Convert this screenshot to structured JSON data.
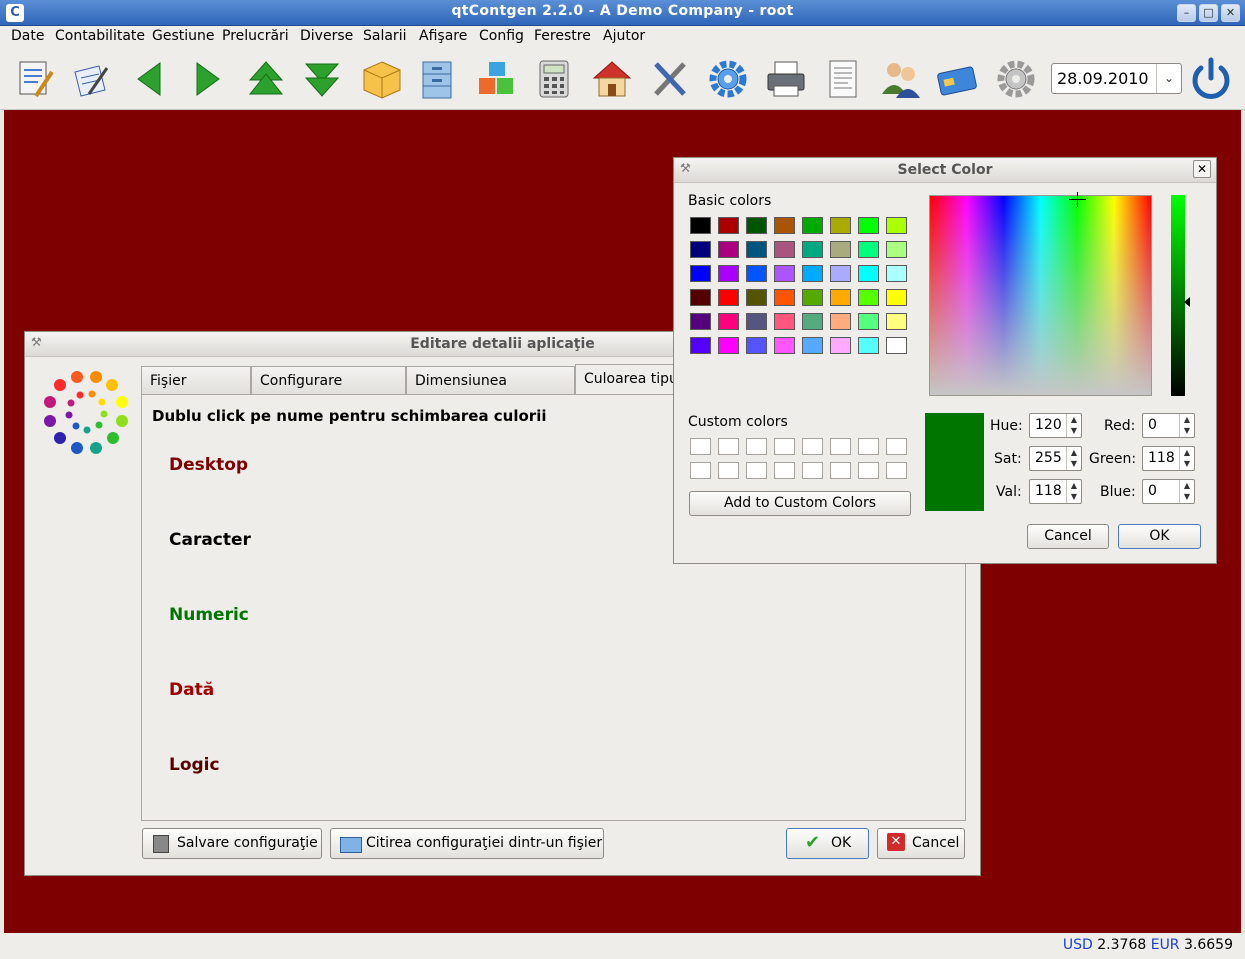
{
  "window": {
    "title": "qtContgen 2.2.0 - A Demo Company - root"
  },
  "menu": [
    {
      "label": "Date"
    },
    {
      "label": "Contabilitate"
    },
    {
      "label": "Gestiune"
    },
    {
      "label": "Prelucrări"
    },
    {
      "label": "Diverse"
    },
    {
      "label": "Salarii"
    },
    {
      "label": "Afişare"
    },
    {
      "label": "Config"
    },
    {
      "label": "Ferestre"
    },
    {
      "label": "Ajutor"
    }
  ],
  "toolbar": {
    "icons": [
      "edit-document-icon",
      "notes-icon",
      "arrow-left-icon",
      "arrow-right-icon",
      "arrow-up-icon",
      "arrow-down-icon",
      "package-icon",
      "filing-cabinet-icon",
      "cubes-icon",
      "calculator-icon",
      "home-icon",
      "tools-icon",
      "gear-blue-icon",
      "printer-icon",
      "report-icon",
      "users-icon",
      "card-icon",
      "gear-gray-icon",
      "power-icon"
    ],
    "date": "28.09.2010"
  },
  "status": {
    "usd_label": "USD",
    "usd_value": "2.3768",
    "eur_label": "EUR",
    "eur_value": "3.6659"
  },
  "app_dialog": {
    "title": "Editare detalii aplicaţie",
    "tabs": [
      "Fişier formule",
      "Configurare aplicaţie",
      "Dimensiunea icoanelor",
      "Culoarea tipur"
    ],
    "active_tab": 3,
    "instruction": "Dublu click pe nume pentru schimbarea culorii",
    "type_names": [
      {
        "label": "Desktop",
        "color": "#7e0000"
      },
      {
        "label": "Caracter",
        "color": "#000000"
      },
      {
        "label": "Numeric",
        "color": "#007600"
      },
      {
        "label": "Dată",
        "color": "#a00000"
      },
      {
        "label": "Logic",
        "color": "#5a0000"
      }
    ],
    "buttons": {
      "save": "Salvare configuraţie",
      "load": "Citirea configuraţiei dintr-un fişier",
      "ok": "OK",
      "cancel": "Cancel"
    }
  },
  "color_dialog": {
    "title": "Select Color",
    "basic_label": "Basic colors",
    "custom_label": "Custom colors",
    "add_custom": "Add to Custom Colors",
    "basic_colors": [
      "#000000",
      "#aa0000",
      "#005500",
      "#aa5500",
      "#00aa00",
      "#aaaa00",
      "#00ff00",
      "#aaff00",
      "#00007f",
      "#aa007f",
      "#00557f",
      "#aa557f",
      "#00aa7f",
      "#aaaa7f",
      "#00ff7f",
      "#aaff7f",
      "#0000ff",
      "#aa00ff",
      "#0055ff",
      "#aa55ff",
      "#00aaff",
      "#aaaaff",
      "#00ffff",
      "#aaffff",
      "#550000",
      "#ff0000",
      "#555500",
      "#ff5500",
      "#55aa00",
      "#ffaa00",
      "#55ff00",
      "#ffff00",
      "#55007f",
      "#ff007f",
      "#55557f",
      "#ff557f",
      "#55aa7f",
      "#ffaa7f",
      "#55ff7f",
      "#ffff7f",
      "#5500ff",
      "#ff00ff",
      "#5555ff",
      "#ff55ff",
      "#55aaff",
      "#ffaaff",
      "#55ffff",
      "#ffffff"
    ],
    "current_color": "#007600",
    "fields": {
      "hue_label": "Hue:",
      "hue": "120",
      "sat_label": "Sat:",
      "sat": "255",
      "val_label": "Val:",
      "val": "118",
      "red_label": "Red:",
      "red": "0",
      "green_label": "Green:",
      "green": "118",
      "blue_label": "Blue:",
      "blue": "0"
    },
    "buttons": {
      "cancel": "Cancel",
      "ok": "OK"
    }
  }
}
